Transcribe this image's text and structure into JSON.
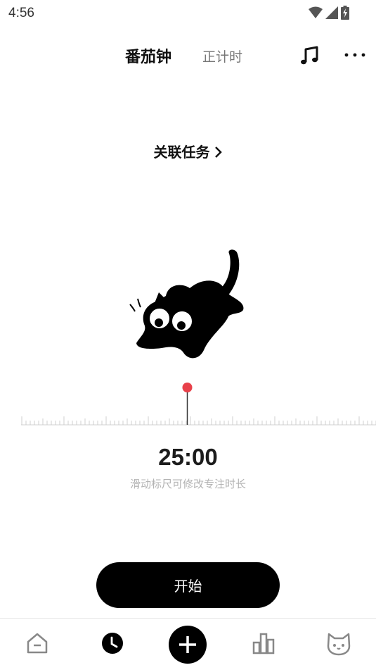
{
  "status_bar": {
    "time": "4:56",
    "icons": [
      "wifi-icon",
      "cellular-signal-icon",
      "battery-charging-icon"
    ]
  },
  "header": {
    "tabs": [
      {
        "label": "番茄钟",
        "active": true
      },
      {
        "label": "正计时",
        "active": false
      }
    ],
    "actions": [
      "music-note-icon",
      "more-icon"
    ]
  },
  "task_link": {
    "label": "关联任务"
  },
  "timer": {
    "value": "25:00",
    "hint": "滑动标尺可修改专注时长"
  },
  "start_button": {
    "label": "开始"
  },
  "bottom_nav": {
    "items": [
      "home-icon",
      "clock-icon",
      "add-icon",
      "stats-icon",
      "cat-icon"
    ],
    "active": "clock-icon"
  },
  "colors": {
    "accent": "#e8414a",
    "primary": "#000000",
    "muted_text": "#b3b3b3"
  }
}
